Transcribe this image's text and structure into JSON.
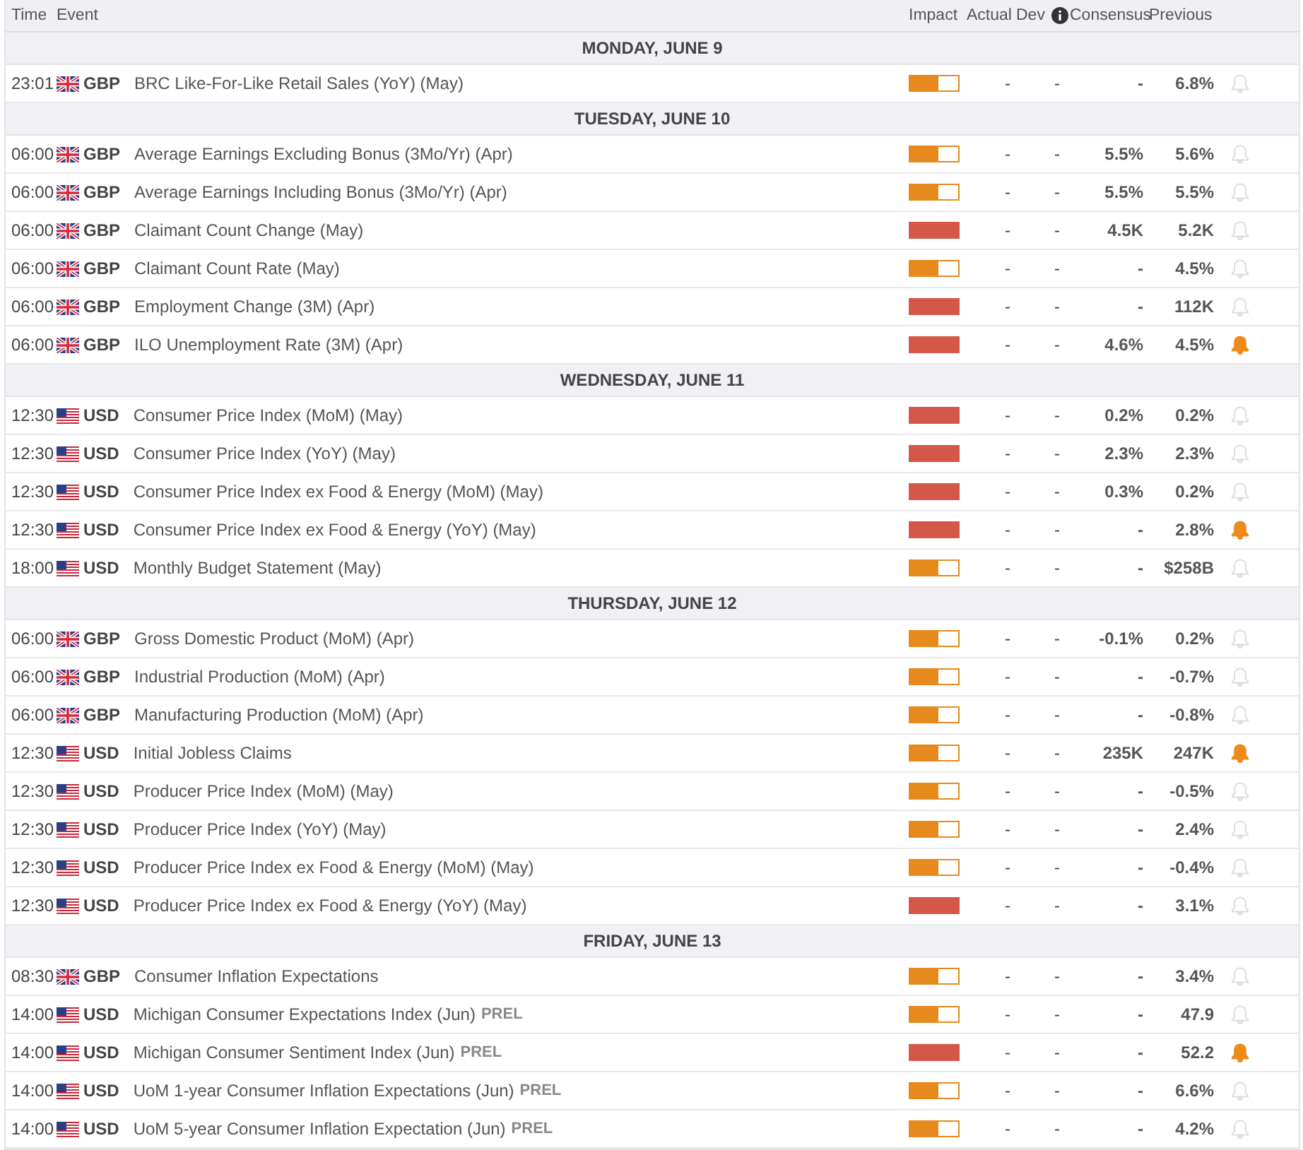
{
  "columns": {
    "time": "Time",
    "event": "Event",
    "impact": "Impact",
    "actual": "Actual",
    "dev": "Dev",
    "consensus": "Consensus",
    "previous": "Previous"
  },
  "days": [
    {
      "title": "MONDAY, JUNE 9",
      "events": [
        {
          "time": "23:01",
          "kind": "uk",
          "currency": "GBP",
          "name": "BRC Like-For-Like Retail Sales (YoY) (May)",
          "level": 0.6,
          "actual": "-",
          "dev": "-",
          "consensus": "-",
          "previous": "6.8%",
          "alert": false
        }
      ]
    },
    {
      "title": "TUESDAY, JUNE 10",
      "events": [
        {
          "time": "06:00",
          "kind": "uk",
          "currency": "GBP",
          "name": "Average Earnings Excluding Bonus (3Mo/Yr) (Apr)",
          "level": 0.6,
          "actual": "-",
          "dev": "-",
          "consensus": "5.5%",
          "previous": "5.6%",
          "alert": false
        },
        {
          "time": "06:00",
          "kind": "uk",
          "currency": "GBP",
          "name": "Average Earnings Including Bonus (3Mo/Yr) (Apr)",
          "level": 0.6,
          "actual": "-",
          "dev": "-",
          "consensus": "5.5%",
          "previous": "5.5%",
          "alert": false
        },
        {
          "time": "06:00",
          "kind": "uk",
          "currency": "GBP",
          "name": "Claimant Count Change (May)",
          "level": 1,
          "actual": "-",
          "dev": "-",
          "consensus": "4.5K",
          "previous": "5.2K",
          "alert": false
        },
        {
          "time": "06:00",
          "kind": "uk",
          "currency": "GBP",
          "name": "Claimant Count Rate (May)",
          "level": 0.6,
          "actual": "-",
          "dev": "-",
          "consensus": "-",
          "previous": "4.5%",
          "alert": false
        },
        {
          "time": "06:00",
          "kind": "uk",
          "currency": "GBP",
          "name": "Employment Change (3M) (Apr)",
          "level": 1,
          "actual": "-",
          "dev": "-",
          "consensus": "-",
          "previous": "112K",
          "alert": false
        },
        {
          "time": "06:00",
          "kind": "uk",
          "currency": "GBP",
          "name": "ILO Unemployment Rate (3M) (Apr)",
          "level": 1,
          "actual": "-",
          "dev": "-",
          "consensus": "4.6%",
          "previous": "4.5%",
          "alert": true
        }
      ]
    },
    {
      "title": "WEDNESDAY, JUNE 11",
      "events": [
        {
          "time": "12:30",
          "kind": "us",
          "currency": "USD",
          "name": "Consumer Price Index (MoM) (May)",
          "level": 1,
          "actual": "-",
          "dev": "-",
          "consensus": "0.2%",
          "previous": "0.2%",
          "alert": false
        },
        {
          "time": "12:30",
          "kind": "us",
          "currency": "USD",
          "name": "Consumer Price Index (YoY) (May)",
          "level": 1,
          "actual": "-",
          "dev": "-",
          "consensus": "2.3%",
          "previous": "2.3%",
          "alert": false
        },
        {
          "time": "12:30",
          "kind": "us",
          "currency": "USD",
          "name": "Consumer Price Index ex Food & Energy (MoM) (May)",
          "level": 1,
          "actual": "-",
          "dev": "-",
          "consensus": "0.3%",
          "previous": "0.2%",
          "alert": false
        },
        {
          "time": "12:30",
          "kind": "us",
          "currency": "USD",
          "name": "Consumer Price Index ex Food & Energy (YoY) (May)",
          "level": 1,
          "actual": "-",
          "dev": "-",
          "consensus": "-",
          "previous": "2.8%",
          "alert": true
        },
        {
          "time": "18:00",
          "kind": "us",
          "currency": "USD",
          "name": "Monthly Budget Statement (May)",
          "level": 0.6,
          "actual": "-",
          "dev": "-",
          "consensus": "-",
          "previous": "$258B",
          "alert": false
        }
      ]
    },
    {
      "title": "THURSDAY, JUNE 12",
      "events": [
        {
          "time": "06:00",
          "kind": "uk",
          "currency": "GBP",
          "name": "Gross Domestic Product (MoM) (Apr)",
          "level": 0.6,
          "actual": "-",
          "dev": "-",
          "consensus": "-0.1%",
          "previous": "0.2%",
          "alert": false
        },
        {
          "time": "06:00",
          "kind": "uk",
          "currency": "GBP",
          "name": "Industrial Production (MoM) (Apr)",
          "level": 0.6,
          "actual": "-",
          "dev": "-",
          "consensus": "-",
          "previous": "-0.7%",
          "alert": false
        },
        {
          "time": "06:00",
          "kind": "uk",
          "currency": "GBP",
          "name": "Manufacturing Production (MoM) (Apr)",
          "level": 0.6,
          "actual": "-",
          "dev": "-",
          "consensus": "-",
          "previous": "-0.8%",
          "alert": false
        },
        {
          "time": "12:30",
          "kind": "us",
          "currency": "USD",
          "name": "Initial Jobless Claims",
          "level": 0.6,
          "actual": "-",
          "dev": "-",
          "consensus": "235K",
          "previous": "247K",
          "alert": true
        },
        {
          "time": "12:30",
          "kind": "us",
          "currency": "USD",
          "name": "Producer Price Index (MoM) (May)",
          "level": 0.6,
          "actual": "-",
          "dev": "-",
          "consensus": "-",
          "previous": "-0.5%",
          "alert": false
        },
        {
          "time": "12:30",
          "kind": "us",
          "currency": "USD",
          "name": "Producer Price Index (YoY) (May)",
          "level": 0.6,
          "actual": "-",
          "dev": "-",
          "consensus": "-",
          "previous": "2.4%",
          "alert": false
        },
        {
          "time": "12:30",
          "kind": "us",
          "currency": "USD",
          "name": "Producer Price Index ex Food & Energy (MoM) (May)",
          "level": 0.6,
          "actual": "-",
          "dev": "-",
          "consensus": "-",
          "previous": "-0.4%",
          "alert": false
        },
        {
          "time": "12:30",
          "kind": "us",
          "currency": "USD",
          "name": "Producer Price Index ex Food & Energy (YoY) (May)",
          "level": 1,
          "actual": "-",
          "dev": "-",
          "consensus": "-",
          "previous": "3.1%",
          "alert": false
        }
      ]
    },
    {
      "title": "FRIDAY, JUNE 13",
      "events": [
        {
          "time": "08:30",
          "kind": "uk",
          "currency": "GBP",
          "name": "Consumer Inflation Expectations",
          "level": 0.6,
          "actual": "-",
          "dev": "-",
          "consensus": "-",
          "previous": "3.4%",
          "alert": false
        },
        {
          "time": "14:00",
          "kind": "us",
          "currency": "USD",
          "name": "Michigan Consumer Expectations Index (Jun)",
          "tag": "PREL",
          "level": 0.6,
          "actual": "-",
          "dev": "-",
          "consensus": "-",
          "previous": "47.9",
          "alert": false
        },
        {
          "time": "14:00",
          "kind": "us",
          "currency": "USD",
          "name": "Michigan Consumer Sentiment Index (Jun)",
          "tag": "PREL",
          "level": 1,
          "actual": "-",
          "dev": "-",
          "consensus": "-",
          "previous": "52.2",
          "alert": true
        },
        {
          "time": "14:00",
          "kind": "us",
          "currency": "USD",
          "name": "UoM 1-year Consumer Inflation Expectations (Jun)",
          "tag": "PREL",
          "level": 0.6,
          "actual": "-",
          "dev": "-",
          "consensus": "-",
          "previous": "6.6%",
          "alert": false
        },
        {
          "time": "14:00",
          "kind": "us",
          "currency": "USD",
          "name": "UoM 5-year Consumer Inflation Expectation (Jun)",
          "tag": "PREL",
          "level": 0.6,
          "actual": "-",
          "dev": "-",
          "consensus": "-",
          "previous": "4.2%",
          "alert": false
        }
      ]
    }
  ]
}
